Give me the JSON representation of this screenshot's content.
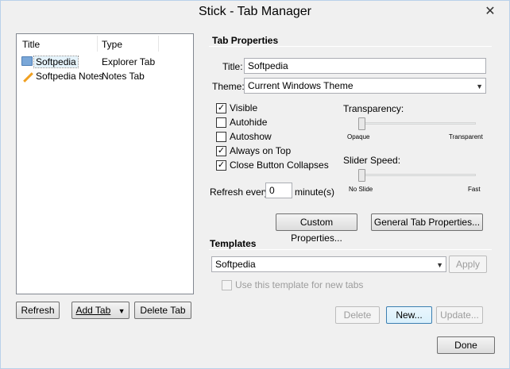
{
  "window": {
    "title": "Stick - Tab Manager",
    "close_glyph": "✕"
  },
  "list": {
    "columns": [
      "Title",
      "Type"
    ],
    "rows": [
      {
        "title": "Softpedia",
        "type": "Explorer Tab",
        "icon": "folder-icon",
        "selected": true
      },
      {
        "title": "Softpedia Notes",
        "type": "Notes Tab",
        "icon": "pencil-icon",
        "selected": false
      }
    ]
  },
  "buttons_left": {
    "refresh": "Refresh",
    "add_tab": "Add Tab",
    "add_tab_arrow": "▼",
    "delete_tab": "Delete Tab"
  },
  "tab_properties": {
    "heading": "Tab Properties",
    "title_label": "Title:",
    "title_value": "Softpedia",
    "theme_label": "Theme:",
    "theme_value": "Current Windows Theme",
    "checks": [
      {
        "label": "Visible",
        "checked": true
      },
      {
        "label": "Autohide",
        "checked": false
      },
      {
        "label": "Autoshow",
        "checked": false
      },
      {
        "label": "Always on Top",
        "checked": true
      },
      {
        "label": "Close Button Collapses",
        "checked": true
      }
    ],
    "transparency_label": "Transparency:",
    "transparency_min": "Opaque",
    "transparency_max": "Transparent",
    "transparency_value": 0,
    "slider_speed_label": "Slider Speed:",
    "slider_speed_min": "No Slide",
    "slider_speed_max": "Fast",
    "slider_speed_value": 0,
    "refresh_label": "Refresh every",
    "refresh_value": "0",
    "refresh_unit": "minute(s)",
    "custom_properties": "Custom Properties...",
    "general_properties": "General Tab Properties..."
  },
  "templates": {
    "heading": "Templates",
    "selected": "Softpedia",
    "apply": "Apply",
    "use_template_label": "Use this template for new tabs",
    "delete": "Delete",
    "new": "New...",
    "update": "Update..."
  },
  "done": "Done"
}
